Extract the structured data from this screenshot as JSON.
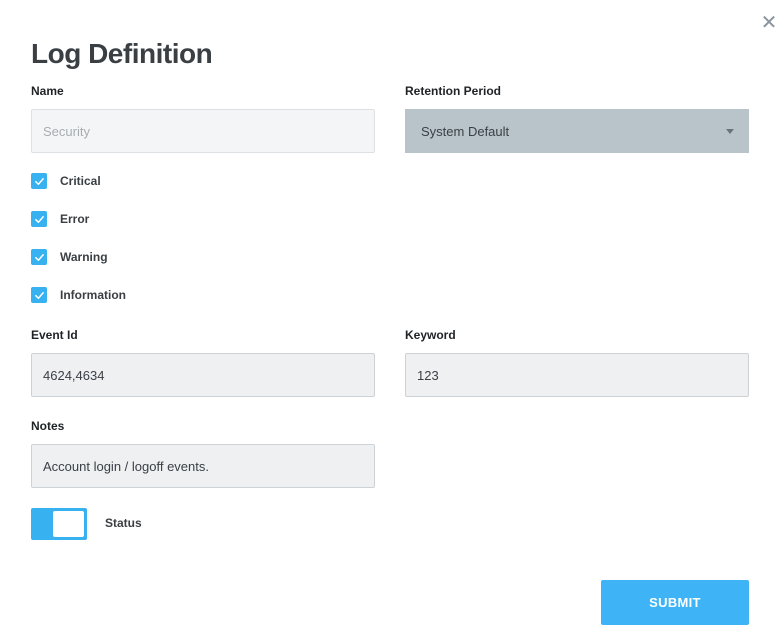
{
  "dialog": {
    "title": "Log Definition",
    "close_glyph": "✕"
  },
  "form": {
    "name": {
      "label": "Name",
      "placeholder": "Security",
      "value": ""
    },
    "retention": {
      "label": "Retention Period",
      "value": "System Default"
    },
    "levels": [
      {
        "label": "Critical",
        "checked": true
      },
      {
        "label": "Error",
        "checked": true
      },
      {
        "label": "Warning",
        "checked": true
      },
      {
        "label": "Information",
        "checked": true
      }
    ],
    "event_id": {
      "label": "Event Id",
      "value": "4624,4634"
    },
    "keyword": {
      "label": "Keyword",
      "value": "123"
    },
    "notes": {
      "label": "Notes",
      "value": "Account login / logoff events."
    },
    "status": {
      "label": "Status",
      "on": true
    },
    "submit_label": "SUBMIT"
  },
  "icons": {
    "close": "close-icon",
    "checkbox": "checkmark-icon",
    "dropdown": "chevron-down-icon"
  },
  "colors": {
    "accent": "#38b1f0",
    "select_bg": "#b8c4ca",
    "field_bg": "#eef0f2"
  }
}
